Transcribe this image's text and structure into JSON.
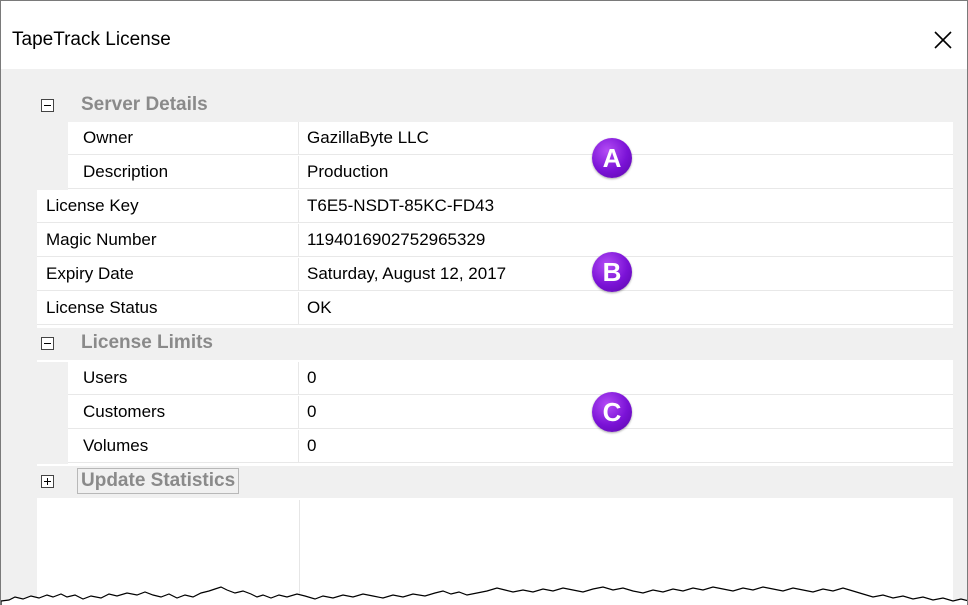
{
  "window": {
    "title": "TapeTrack License",
    "close_icon": "close-icon"
  },
  "categories": {
    "server_details": {
      "label": "Server Details",
      "expanded": true
    },
    "license_limits": {
      "label": "License Limits",
      "expanded": true
    },
    "update_statistics": {
      "label": "Update Statistics",
      "expanded": false
    }
  },
  "server_details": [
    {
      "name": "Owner",
      "value": "GazillaByte LLC"
    },
    {
      "name": "Description",
      "value": "Production"
    }
  ],
  "license_info": [
    {
      "name": "License Key",
      "value": "T6E5-NSDT-85KC-FD43"
    },
    {
      "name": "Magic Number",
      "value": "1194016902752965329"
    },
    {
      "name": "Expiry Date",
      "value": "Saturday, August 12, 2017"
    },
    {
      "name": "License Status",
      "value": "OK"
    }
  ],
  "license_limits": [
    {
      "name": "Users",
      "value": "0"
    },
    {
      "name": "Customers",
      "value": "0"
    },
    {
      "name": "Volumes",
      "value": "0"
    }
  ],
  "annotations": {
    "a": "A",
    "b": "B",
    "c": "C",
    "color": "#7a12d6"
  }
}
